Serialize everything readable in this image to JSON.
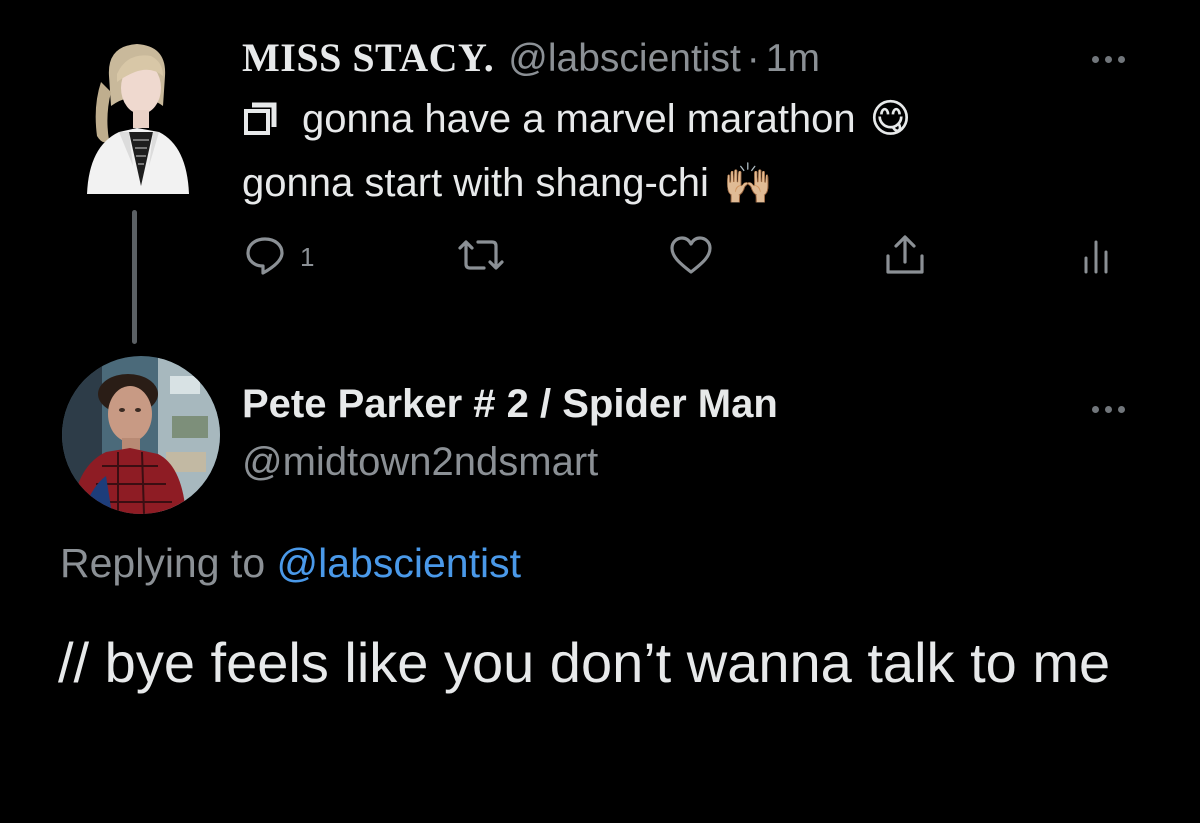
{
  "parent_tweet": {
    "display_name": "MISS STACY.",
    "handle": "@labscientist",
    "separator": "·",
    "timestamp": "1m",
    "line1": "gonna have a marvel marathon",
    "line1_emoji": "😋",
    "line2": "gonna start with shang-chi",
    "line2_emoji": "🙌🏼",
    "reply_count": "1"
  },
  "reply_tweet": {
    "display_name": "Pete Parker # 2 / Spider Man",
    "handle": "@midtown2ndsmart",
    "replying_prefix": "Replying to",
    "replying_mention": "@labscientist",
    "text": "// bye feels like you don’t wanna talk to me"
  },
  "colors": {
    "background": "#000000",
    "text_primary": "#e7e9ea",
    "text_secondary": "#8b9095",
    "link": "#4a99e9",
    "thread_line": "#5b6064"
  },
  "icons": {
    "reply": "comment-bubble-icon",
    "retweet": "retweet-icon",
    "like": "heart-icon",
    "share": "share-icon",
    "analytics": "analytics-bars-icon",
    "more": "more-dots-icon"
  }
}
